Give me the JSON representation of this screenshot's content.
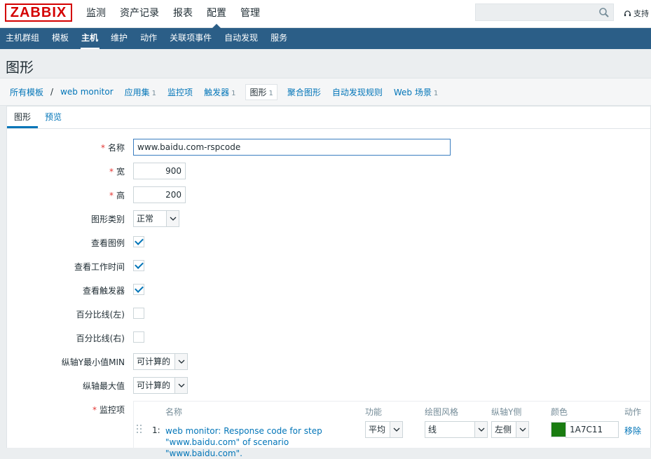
{
  "brand": {
    "logo": "ZABBIX"
  },
  "top_menu": [
    "监测",
    "资产记录",
    "报表",
    "配置",
    "管理"
  ],
  "top_menu_selected": "配置",
  "search": {
    "placeholder": ""
  },
  "support_label": "支持",
  "sub_menu": [
    "主机群组",
    "模板",
    "主机",
    "维护",
    "动作",
    "关联项事件",
    "自动发现",
    "服务"
  ],
  "sub_menu_selected": "主机",
  "page_title": "图形",
  "breadcrumbs": {
    "all_templates": "所有模板",
    "host": "web monitor",
    "apps": {
      "label": "应用集",
      "count": "1"
    },
    "items": {
      "label": "监控项"
    },
    "triggers": {
      "label": "触发器",
      "count": "1"
    },
    "graphs": {
      "label": "图形",
      "count": "1"
    },
    "screens": {
      "label": "聚合图形"
    },
    "discovery": {
      "label": "自动发现规则"
    },
    "web": {
      "label": "Web 场景",
      "count": "1"
    }
  },
  "tabs": [
    "图形",
    "预览"
  ],
  "form": {
    "name": {
      "label": "名称",
      "value": "www.baidu.com-rspcode"
    },
    "width": {
      "label": "宽",
      "value": "900"
    },
    "height": {
      "label": "高",
      "value": "200"
    },
    "graph_type": {
      "label": "图形类别",
      "value": "正常"
    },
    "show_legend": {
      "label": "查看图例",
      "checked": true
    },
    "show_work_period": {
      "label": "查看工作时间",
      "checked": true
    },
    "show_triggers": {
      "label": "查看触发器",
      "checked": true
    },
    "percentile_left": {
      "label": "百分比线(左)",
      "checked": false
    },
    "percentile_right": {
      "label": "百分比线(右)",
      "checked": false
    },
    "ymin": {
      "label": "纵轴Y最小值MIN",
      "value": "可计算的"
    },
    "ymax": {
      "label": "纵轴最大值",
      "value": "可计算的"
    },
    "items_label": "监控项"
  },
  "items_table": {
    "headers": {
      "name": "名称",
      "function": "功能",
      "draw_style": "绘图风格",
      "y_axis": "纵轴Y侧",
      "color": "颜色",
      "action": "动作"
    },
    "rows": [
      {
        "index": "1:",
        "name_line1": "web monitor: Response code for step",
        "name_line2": "\"www.baidu.com\" of scenario \"www.baidu.com\".",
        "function": "平均",
        "draw_style": "线",
        "y_axis": "左侧",
        "color": "1A7C11",
        "remove": "移除"
      }
    ]
  },
  "colors": {
    "accent": "#0275b8",
    "nav": "#2b5e87",
    "item_color": "#1A7C11",
    "logo": "#d40000"
  }
}
